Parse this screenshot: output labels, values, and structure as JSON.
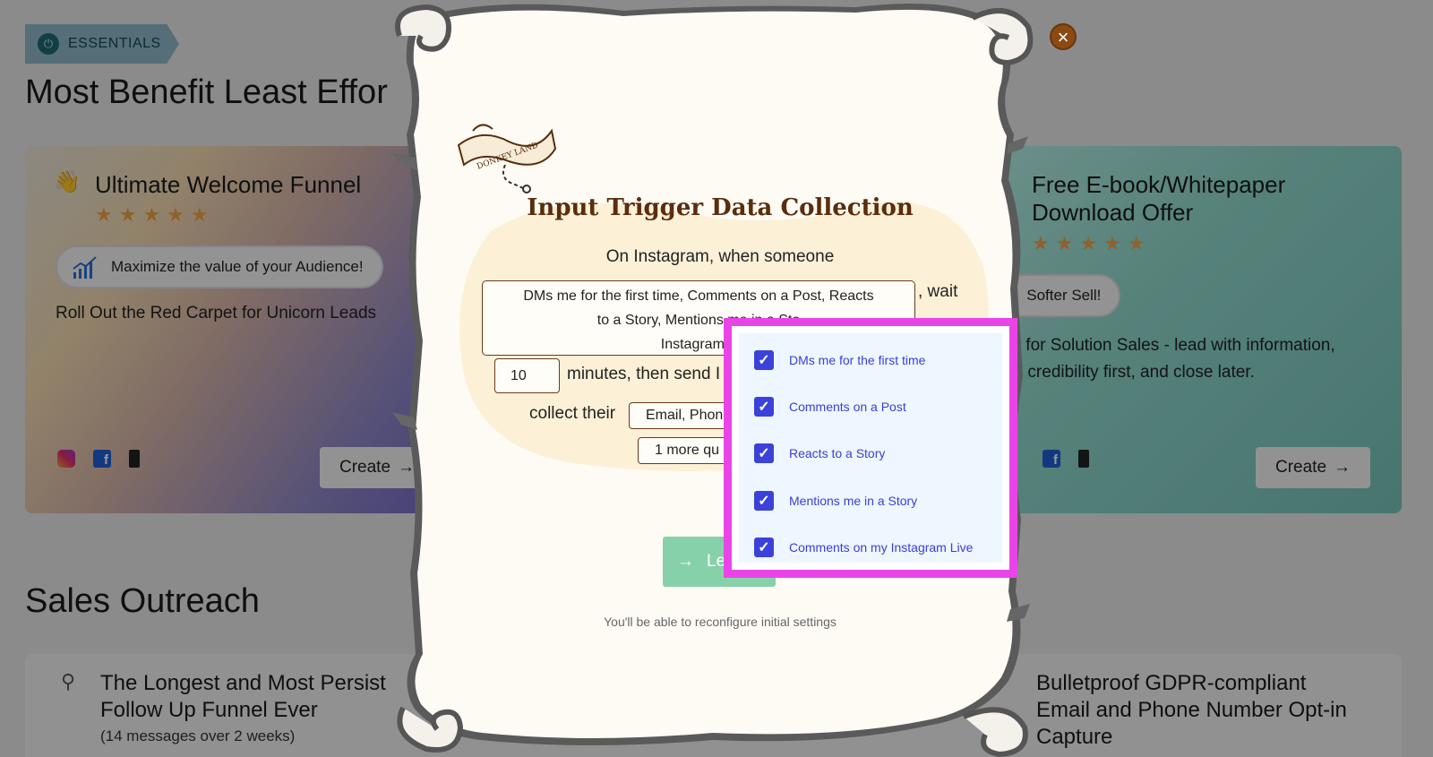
{
  "background": {
    "badge_label": "ESSENTIALS",
    "section_title": "Most Benefit Least Effor",
    "section2_title": "Sales Outreach",
    "card_left": {
      "emoji": "👋",
      "title": "Ultimate Welcome Funnel",
      "stars": "★★★★★",
      "pill_label": "Maximize the value of your Audience!",
      "description": "Roll Out the Red Carpet for Unicorn Leads",
      "create_label": "Create"
    },
    "card_right": {
      "title_line1": "Free E-book/Whitepaper",
      "title_line2": "Download Offer",
      "stars": "★★★★★",
      "pill_label": "Softer Sell!",
      "desc_line1": "Best for Solution Sales - lead with information,",
      "desc_line2": "build credibility first, and close later.",
      "create_label": "Create"
    },
    "card_bottom_left": {
      "title_line1": "The Longest and Most Persist",
      "title_line2": "Follow Up Funnel Ever",
      "subtitle": "(14 messages over 2 weeks)"
    },
    "card_bottom_right": {
      "title_line1": "Bulletproof GDPR-compliant",
      "title_line2": "Email and Phone Number Opt-in",
      "title_line3": "Capture"
    }
  },
  "modal": {
    "logo_text": "DONKEY LAND",
    "title": "Input Trigger Data Collection",
    "intro": "On Instagram, when someone",
    "trigger_line1": "DMs me for the first time, Comments on a Post, Reacts",
    "trigger_line2": "to a Story, Mentions me in a Sto",
    "trigger_line3": "Instagram L",
    "wait_text": ", wait",
    "minutes_value": "10",
    "minutes_text": "minutes, then send I",
    "collect_text": "collect their",
    "collect_value": "Email, Phon",
    "more_value": "1 more qu",
    "go_label": "Let",
    "footnote": "You'll be able to reconfigure initial settings",
    "close_icon": "×"
  },
  "dropdown": {
    "options": [
      {
        "label": "DMs me for the first time",
        "checked": true
      },
      {
        "label": "Comments on a Post",
        "checked": true
      },
      {
        "label": "Reacts to a Story",
        "checked": true
      },
      {
        "label": "Mentions me in a Story",
        "checked": true
      },
      {
        "label": "Comments on my Instagram Live",
        "checked": true
      }
    ],
    "highlight_color": "#ea44e8",
    "checkbox_color": "#3b42d9"
  },
  "colors": {
    "title_brown": "#5a2d0c",
    "close_button": "#8b4a14",
    "go_button": "#86d1a9"
  }
}
